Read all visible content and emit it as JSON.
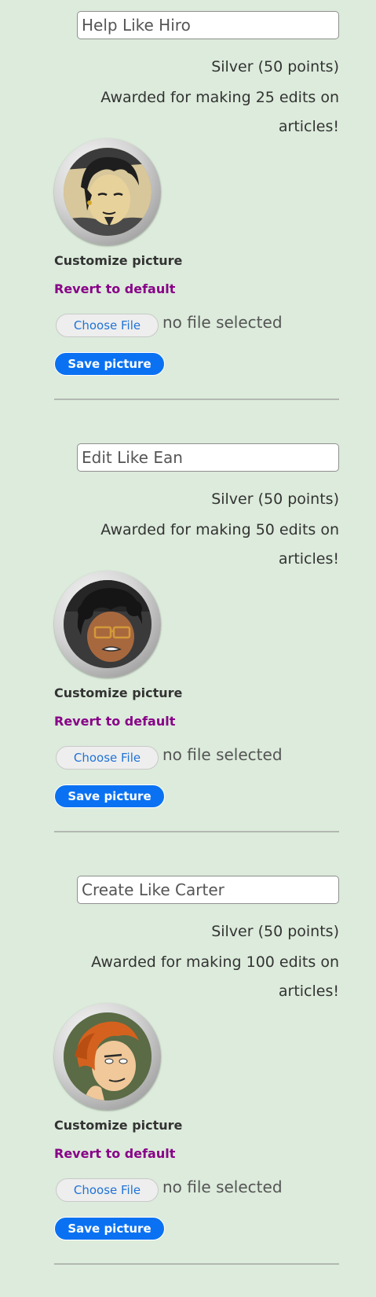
{
  "badges": [
    {
      "name": "Help Like Hiro",
      "level": "Silver (50 points)",
      "description": "Awarded for making 25 edits on articles!",
      "customize_label": "Customize picture",
      "revert_label": "Revert to default",
      "choose_file_label": "Choose File",
      "file_status": "no file selected",
      "save_label": "Save picture"
    },
    {
      "name": "Edit Like Ean",
      "level": "Silver (50 points)",
      "description": "Awarded for making 50 edits on articles!",
      "customize_label": "Customize picture",
      "revert_label": "Revert to default",
      "choose_file_label": "Choose File",
      "file_status": "no file selected",
      "save_label": "Save picture"
    },
    {
      "name": "Create Like Carter",
      "level": "Silver (50 points)",
      "description": "Awarded for making 100 edits on articles!",
      "customize_label": "Customize picture",
      "revert_label": "Revert to default",
      "choose_file_label": "Choose File",
      "file_status": "no file selected",
      "save_label": "Save picture"
    }
  ],
  "colors": {
    "background": "#dcebdb",
    "revert_link": "#880088",
    "save_button": "#0a72f2",
    "choose_file_text": "#1f73d6"
  }
}
